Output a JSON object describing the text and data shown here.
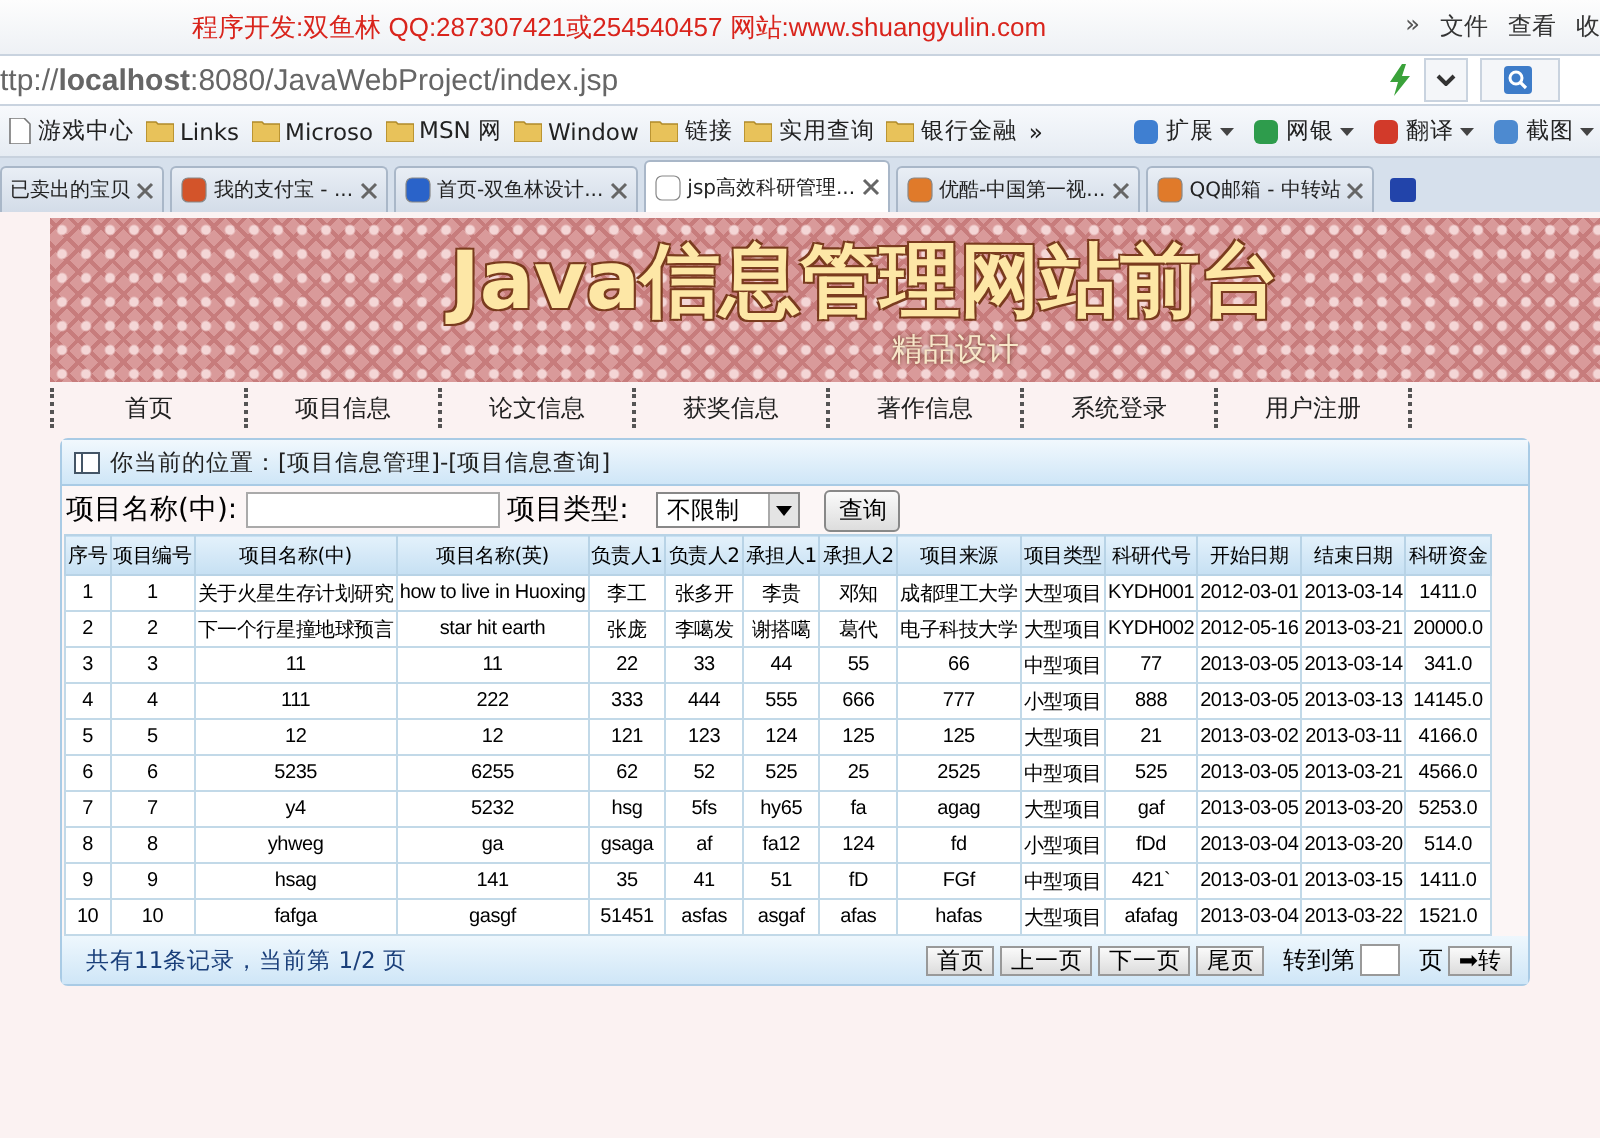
{
  "title_bar": {
    "text": "程序开发:双鱼林 QQ:287307421或254540457 网站:www.shuangyulin.com",
    "chevron": "»",
    "menu": [
      "文件",
      "查看",
      "收"
    ]
  },
  "address_bar": {
    "url": "ttp://**localhost**:8080/JavaWebProject/index.jsp"
  },
  "bookmarks": [
    {
      "label": "游戏中心",
      "kind": "page"
    },
    {
      "label": "Links",
      "kind": "folder"
    },
    {
      "label": "Microso",
      "kind": "folder"
    },
    {
      "label": "MSN 网",
      "kind": "folder"
    },
    {
      "label": "Window",
      "kind": "folder"
    },
    {
      "label": "链接",
      "kind": "folder"
    },
    {
      "label": "实用查询",
      "kind": "folder"
    },
    {
      "label": "银行金融",
      "kind": "folder"
    }
  ],
  "bookmarks_more": "»",
  "tools": [
    "扩展",
    "网银",
    "翻译",
    "截图"
  ],
  "tabs": [
    {
      "label": "已卖出的宝贝",
      "selected": false
    },
    {
      "label": "我的支付宝 - ...",
      "selected": false
    },
    {
      "label": "首页-双鱼林设计...",
      "selected": false
    },
    {
      "label": "jsp高效科研管理...",
      "selected": true
    },
    {
      "label": "优酷-中国第一视...",
      "selected": false
    },
    {
      "label": "QQ邮箱 - 中转站",
      "selected": false
    }
  ],
  "banner": {
    "title": "Java信息管理网站前台",
    "subtitle": "精品设计"
  },
  "nav": [
    "首页",
    "项目信息",
    "论文信息",
    "获奖信息",
    "著作信息",
    "系统登录",
    "用户注册"
  ],
  "breadcrumb": "你当前的位置：[项目信息管理]-[项目信息查询]",
  "search": {
    "name_label": "项目名称(中):",
    "type_label": "项目类型:",
    "type_value": "不限制",
    "button": "查询"
  },
  "table": {
    "columns": [
      "序号",
      "项目编号",
      "项目名称(中)",
      "项目名称(英)",
      "负责人1",
      "负责人2",
      "承担人1",
      "承担人2",
      "项目来源",
      "项目类型",
      "科研代号",
      "开始日期",
      "结束日期",
      "科研资金"
    ],
    "rows": [
      [
        "1",
        "1",
        "关于火星生存计划研究",
        "how to live in Huoxing",
        "李工",
        "张多开",
        "李贵",
        "邓知",
        "成都理工大学",
        "大型项目",
        "KYDH001",
        "2012-03-01",
        "2013-03-14",
        "1411.0"
      ],
      [
        "2",
        "2",
        "下一个行星撞地球预言",
        "star hit earth",
        "张庞",
        "李噶发",
        "谢搭噶",
        "葛代",
        "电子科技大学",
        "大型项目",
        "KYDH002",
        "2012-05-16",
        "2013-03-21",
        "20000.0"
      ],
      [
        "3",
        "3",
        "11",
        "11",
        "22",
        "33",
        "44",
        "55",
        "66",
        "中型项目",
        "77",
        "2013-03-05",
        "2013-03-14",
        "341.0"
      ],
      [
        "4",
        "4",
        "111",
        "222",
        "333",
        "444",
        "555",
        "666",
        "777",
        "小型项目",
        "888",
        "2013-03-05",
        "2013-03-13",
        "14145.0"
      ],
      [
        "5",
        "5",
        "12",
        "12",
        "121",
        "123",
        "124",
        "125",
        "125",
        "大型项目",
        "21",
        "2013-03-02",
        "2013-03-11",
        "4166.0"
      ],
      [
        "6",
        "6",
        "5235",
        "6255",
        "62",
        "52",
        "525",
        "25",
        "2525",
        "中型项目",
        "525",
        "2013-03-05",
        "2013-03-21",
        "4566.0"
      ],
      [
        "7",
        "7",
        "y4",
        "5232",
        "hsg",
        "5fs",
        "hy65",
        "fa",
        "agag",
        "大型项目",
        "gaf",
        "2013-03-05",
        "2013-03-20",
        "5253.0"
      ],
      [
        "8",
        "8",
        "yhweg",
        "ga",
        "gsaga",
        "af",
        "fa12",
        "124",
        "fd",
        "小型项目",
        "fDd",
        "2013-03-04",
        "2013-03-20",
        "514.0"
      ],
      [
        "9",
        "9",
        "hsag",
        "141",
        "35",
        "41",
        "51",
        "fD",
        "FGf",
        "中型项目",
        "421`",
        "2013-03-01",
        "2013-03-15",
        "1411.0"
      ],
      [
        "10",
        "10",
        "fafga",
        "gasgf",
        "51451",
        "asfas",
        "asgaf",
        "afas",
        "hafas",
        "大型项目",
        "afafag",
        "2013-03-04",
        "2013-03-22",
        "1521.0"
      ]
    ]
  },
  "pager": {
    "summary": "共有11条记录，当前第 1/2 页",
    "buttons": [
      "首页",
      "上一页",
      "下一页",
      "尾页"
    ],
    "goto_label": "转到第",
    "page_label": "页",
    "go_button": "➡转"
  }
}
